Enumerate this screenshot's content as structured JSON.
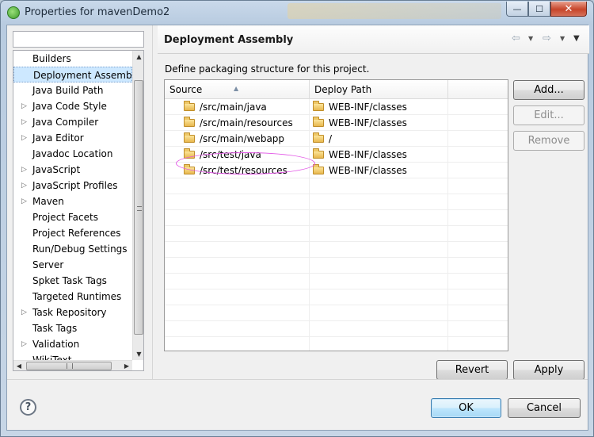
{
  "window": {
    "title": "Properties for mavenDemo2",
    "controls": {
      "minimize": "—",
      "maximize": "☐",
      "close": "✕"
    }
  },
  "nav": {
    "filter": {
      "value": "",
      "placeholder": ""
    },
    "items": [
      {
        "label": "Builders",
        "expandable": false,
        "selected": false
      },
      {
        "label": "Deployment Assembly",
        "expandable": false,
        "selected": true
      },
      {
        "label": "Java Build Path",
        "expandable": false,
        "selected": false
      },
      {
        "label": "Java Code Style",
        "expandable": true,
        "selected": false
      },
      {
        "label": "Java Compiler",
        "expandable": true,
        "selected": false
      },
      {
        "label": "Java Editor",
        "expandable": true,
        "selected": false
      },
      {
        "label": "Javadoc Location",
        "expandable": false,
        "selected": false
      },
      {
        "label": "JavaScript",
        "expandable": true,
        "selected": false
      },
      {
        "label": "JavaScript Profiles",
        "expandable": true,
        "selected": false
      },
      {
        "label": "Maven",
        "expandable": true,
        "selected": false
      },
      {
        "label": "Project Facets",
        "expandable": false,
        "selected": false
      },
      {
        "label": "Project References",
        "expandable": false,
        "selected": false
      },
      {
        "label": "Run/Debug Settings",
        "expandable": false,
        "selected": false
      },
      {
        "label": "Server",
        "expandable": false,
        "selected": false
      },
      {
        "label": "Spket Task Tags",
        "expandable": false,
        "selected": false
      },
      {
        "label": "Targeted Runtimes",
        "expandable": false,
        "selected": false
      },
      {
        "label": "Task Repository",
        "expandable": true,
        "selected": false
      },
      {
        "label": "Task Tags",
        "expandable": false,
        "selected": false
      },
      {
        "label": "Validation",
        "expandable": true,
        "selected": false
      },
      {
        "label": "WikiText",
        "expandable": false,
        "selected": false
      }
    ]
  },
  "panel": {
    "title": "Deployment Assembly",
    "description": "Define packaging structure for this project.",
    "table": {
      "columns": [
        "Source",
        "Deploy Path",
        ""
      ],
      "rows": [
        {
          "source": "/src/main/java",
          "deploy": "WEB-INF/classes"
        },
        {
          "source": "/src/main/resources",
          "deploy": "WEB-INF/classes"
        },
        {
          "source": "/src/main/webapp",
          "deploy": "/"
        },
        {
          "source": "/src/test/java",
          "deploy": "WEB-INF/classes"
        },
        {
          "source": "/src/test/resources",
          "deploy": "WEB-INF/classes"
        }
      ],
      "highlighted_row": 2
    },
    "buttons": {
      "add": "Add...",
      "edit": "Edit...",
      "remove": "Remove",
      "revert": "Revert",
      "apply": "Apply"
    }
  },
  "footer": {
    "help": "?",
    "ok": "OK",
    "cancel": "Cancel"
  },
  "colors": {
    "selection": "#cde8ff",
    "highlight_ellipse": "#e255e6",
    "folder": "#e8b84e"
  }
}
